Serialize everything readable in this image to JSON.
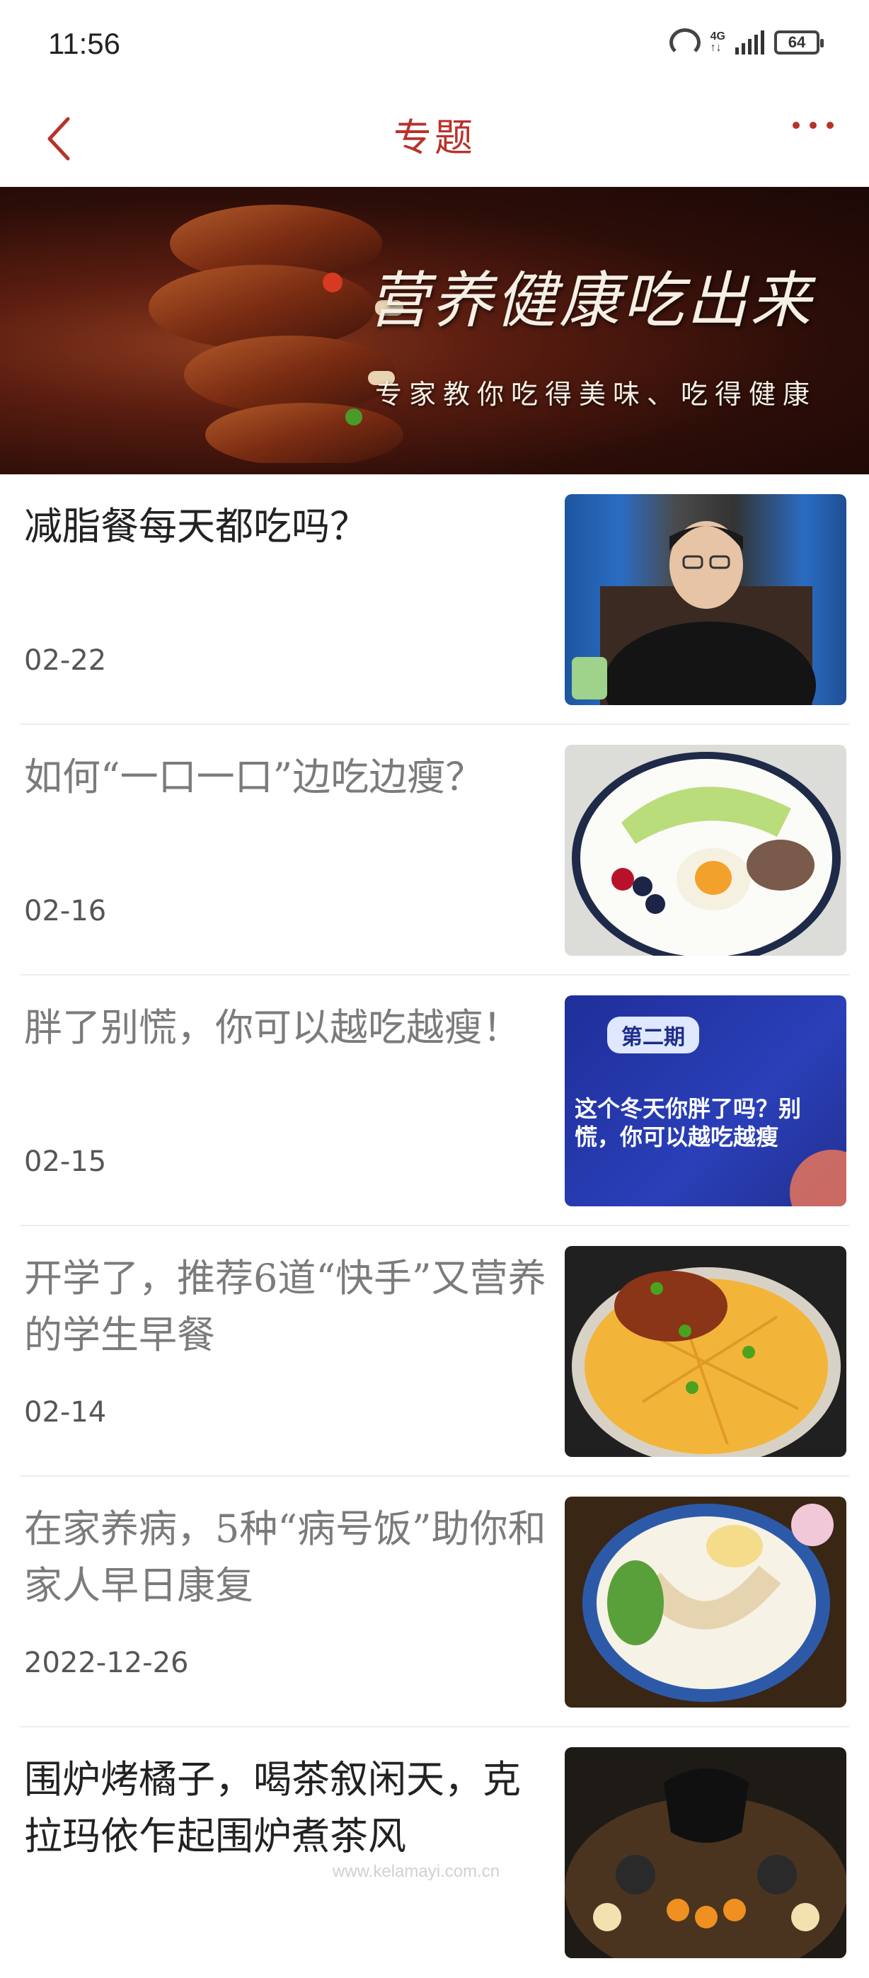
{
  "status_bar": {
    "time": "11:56",
    "network_top": "4G",
    "network_bottom": "↑↓",
    "battery": "64"
  },
  "nav": {
    "back_icon": "chevron-left-icon",
    "title": "专题",
    "more_icon": "more-dots-icon",
    "accent_color": "#b8322a"
  },
  "banner": {
    "title": "营养健康吃出来",
    "subtitle": "专家教你吃得美味、吃得健康"
  },
  "articles": [
    {
      "title": "减脂餐每天都吃吗？",
      "date": "02-22",
      "read": false
    },
    {
      "title": "如何“一口一口”边吃边瘦？",
      "date": "02-16",
      "read": true
    },
    {
      "title": "胖了别慌，你可以越吃越瘦！",
      "date": "02-15",
      "read": true,
      "thumb_tag": "第二期",
      "thumb_caption": "这个冬天你胖了吗？别慌，你可以越吃越瘦"
    },
    {
      "title": "开学了，推荐6道“快手”又营养的学生早餐",
      "date": "02-14",
      "read": true
    },
    {
      "title": "在家养病，5种“病号饭”助你和家人早日康复",
      "date": "2022-12-26",
      "read": true
    },
    {
      "title": "围炉烤橘子，喝茶叙闲天，克拉玛依乍起围炉煮茶风",
      "date": "",
      "read": false
    }
  ],
  "watermark": "www.kelamayi.com.cn"
}
